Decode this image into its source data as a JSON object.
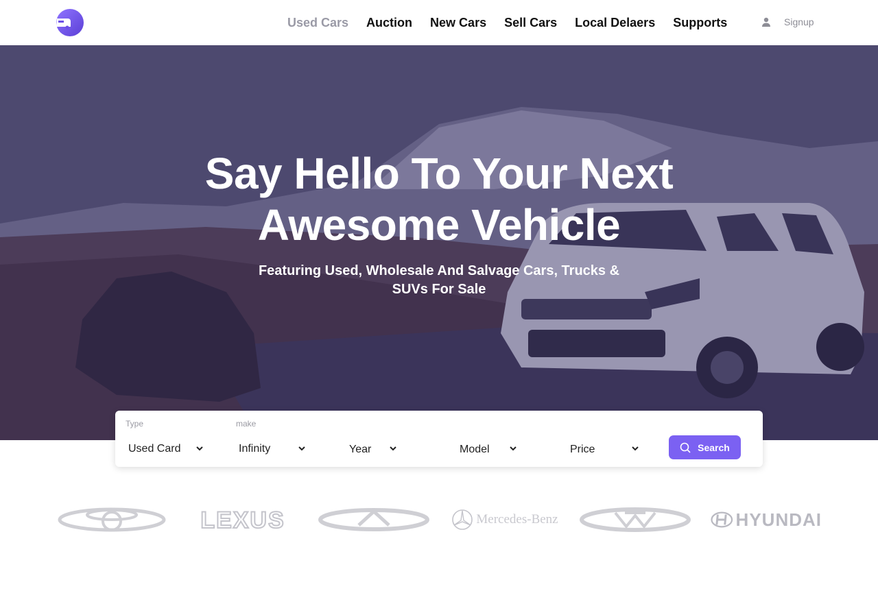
{
  "header": {
    "logo_icon": "car-logo-icon",
    "nav": [
      {
        "label": "Used Cars",
        "active": true
      },
      {
        "label": "Auction"
      },
      {
        "label": "New Cars"
      },
      {
        "label": "Sell Cars"
      },
      {
        "label": "Local Delaers"
      },
      {
        "label": "Supports"
      }
    ],
    "signup_label": "Signup",
    "signup_icon": "user-icon"
  },
  "hero": {
    "title_line1": "Say Hello To Your Next",
    "title_line2": "Awesome Vehicle",
    "subtitle": "Featuring Used, Wholesale And Salvage Cars, Trucks & SUVs For Sale"
  },
  "search": {
    "type": {
      "label": "Type",
      "value": "Used Card"
    },
    "make": {
      "label": "make",
      "value": "Infinity"
    },
    "year": {
      "value": "Year"
    },
    "model": {
      "value": "Model"
    },
    "price": {
      "value": "Price"
    },
    "button_label": "Search",
    "button_icon": "search-icon"
  },
  "brands": [
    {
      "name": "Toyota",
      "icon": "toyota-logo-icon"
    },
    {
      "name": "LEXUS",
      "icon": "lexus-logo-icon"
    },
    {
      "name": "Infiniti",
      "icon": "infiniti-logo-icon"
    },
    {
      "name": "Mercedes-Benz",
      "icon": "mercedes-benz-logo-icon"
    },
    {
      "name": "Volkswagen",
      "icon": "volkswagen-logo-icon"
    },
    {
      "name": "HYUNDAI",
      "icon": "hyundai-logo-icon"
    }
  ],
  "colors": {
    "accent": "#7b61f2",
    "nav_active": "#9a9aa6",
    "hero_overlay": "#342c64",
    "brand_logo": "#c9c9cf"
  }
}
